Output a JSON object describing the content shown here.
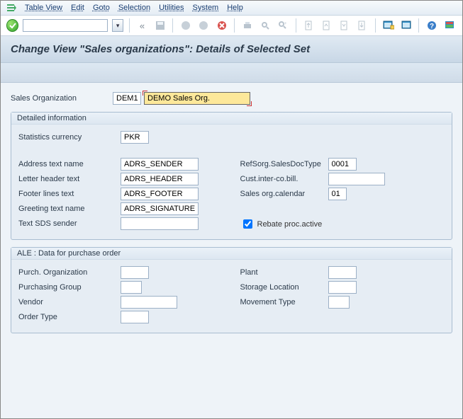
{
  "menu": {
    "items": [
      "Table View",
      "Edit",
      "Goto",
      "Selection",
      "Utilities",
      "System",
      "Help"
    ]
  },
  "title": "Change View \"Sales organizations\": Details of Selected Set",
  "header": {
    "salesOrgLabel": "Sales Organization",
    "salesOrgCode": "DEM1",
    "salesOrgName": "DEMO Sales Org."
  },
  "group1": {
    "title": "Detailed information",
    "statsCurrencyLabel": "Statistics currency",
    "statsCurrency": "PKR",
    "left": {
      "addrLabel": "Address text name",
      "addr": "ADRS_SENDER",
      "letterLabel": "Letter header text",
      "letter": "ADRS_HEADER",
      "footerLabel": "Footer lines text",
      "footer": "ADRS_FOOTER",
      "greetLabel": "Greeting text name",
      "greet": "ADRS_SIGNATURE",
      "sdsLabel": "Text SDS sender",
      "sds": ""
    },
    "right": {
      "refSorgLabel": "RefSorg.SalesDocType",
      "refSorg": "0001",
      "custInterLabel": "Cust.inter-co.bill.",
      "custInter": "",
      "salesCalLabel": "Sales org.calendar",
      "salesCal": "01",
      "rebateLabel": "Rebate proc.active",
      "rebateChecked": true
    }
  },
  "group2": {
    "title": "ALE : Data for purchase order",
    "left": {
      "purchOrgLabel": "Purch. Organization",
      "purchOrg": "",
      "purchGrpLabel": "Purchasing Group",
      "purchGrp": "",
      "vendorLabel": "Vendor",
      "vendor": "",
      "orderTypeLabel": "Order Type",
      "orderType": ""
    },
    "right": {
      "plantLabel": "Plant",
      "plant": "",
      "storLocLabel": "Storage Location",
      "storLoc": "",
      "moveTypeLabel": "Movement Type",
      "moveType": ""
    }
  }
}
